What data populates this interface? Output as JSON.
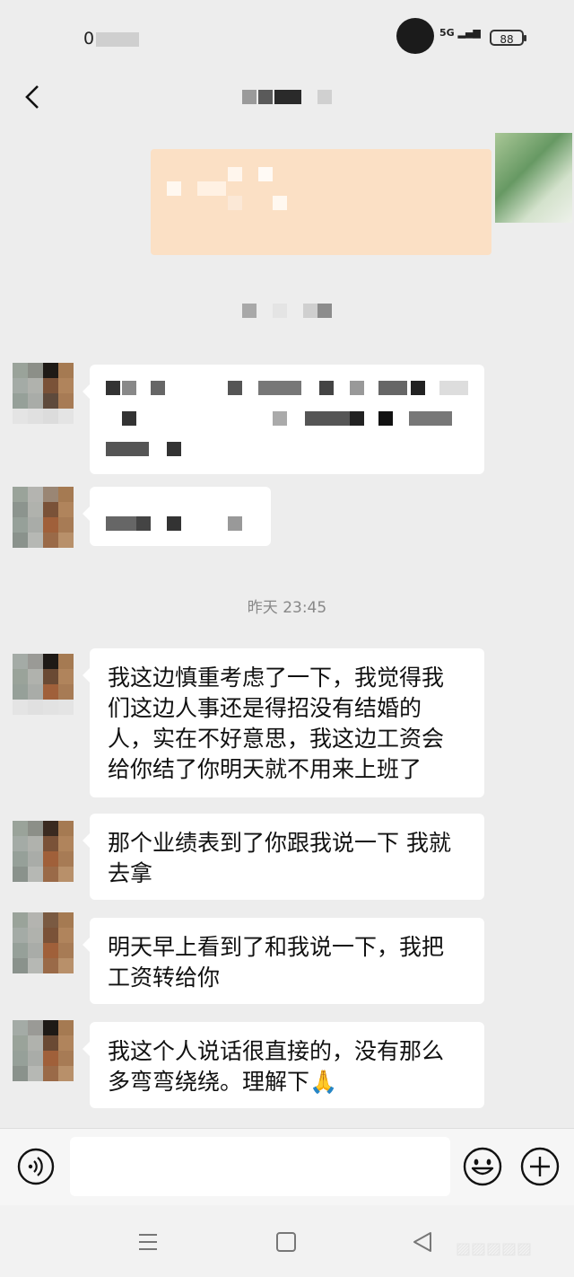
{
  "status_bar": {
    "time": "0",
    "network": "5G",
    "battery": "88"
  },
  "header": {
    "back_icon": "chevron-left-icon"
  },
  "timestamp": "昨天 23:45",
  "messages": [
    {
      "text": "我这边慎重考虑了一下，我觉得我\n们这边人事还是得招没有结婚的\n人，实在不好意思，我这边工资会\n给你结了你明天就不用来上班了"
    },
    {
      "text": "那个业绩表到了你跟我说一下 我就\n去拿"
    },
    {
      "text": "明天早上看到了和我说一下，我把\n工资转给你"
    },
    {
      "text": "我这个人说话很直接的，没有那么\n多弯弯绕绕。理解下🙏"
    }
  ],
  "input_bar": {
    "voice_icon": "voice-icon",
    "emoji_icon": "emoji-icon",
    "plus_icon": "plus-icon",
    "input_value": ""
  },
  "nav": {
    "menu_icon": "menu-icon",
    "home_icon": "square-icon",
    "back_icon": "triangle-back-icon"
  }
}
